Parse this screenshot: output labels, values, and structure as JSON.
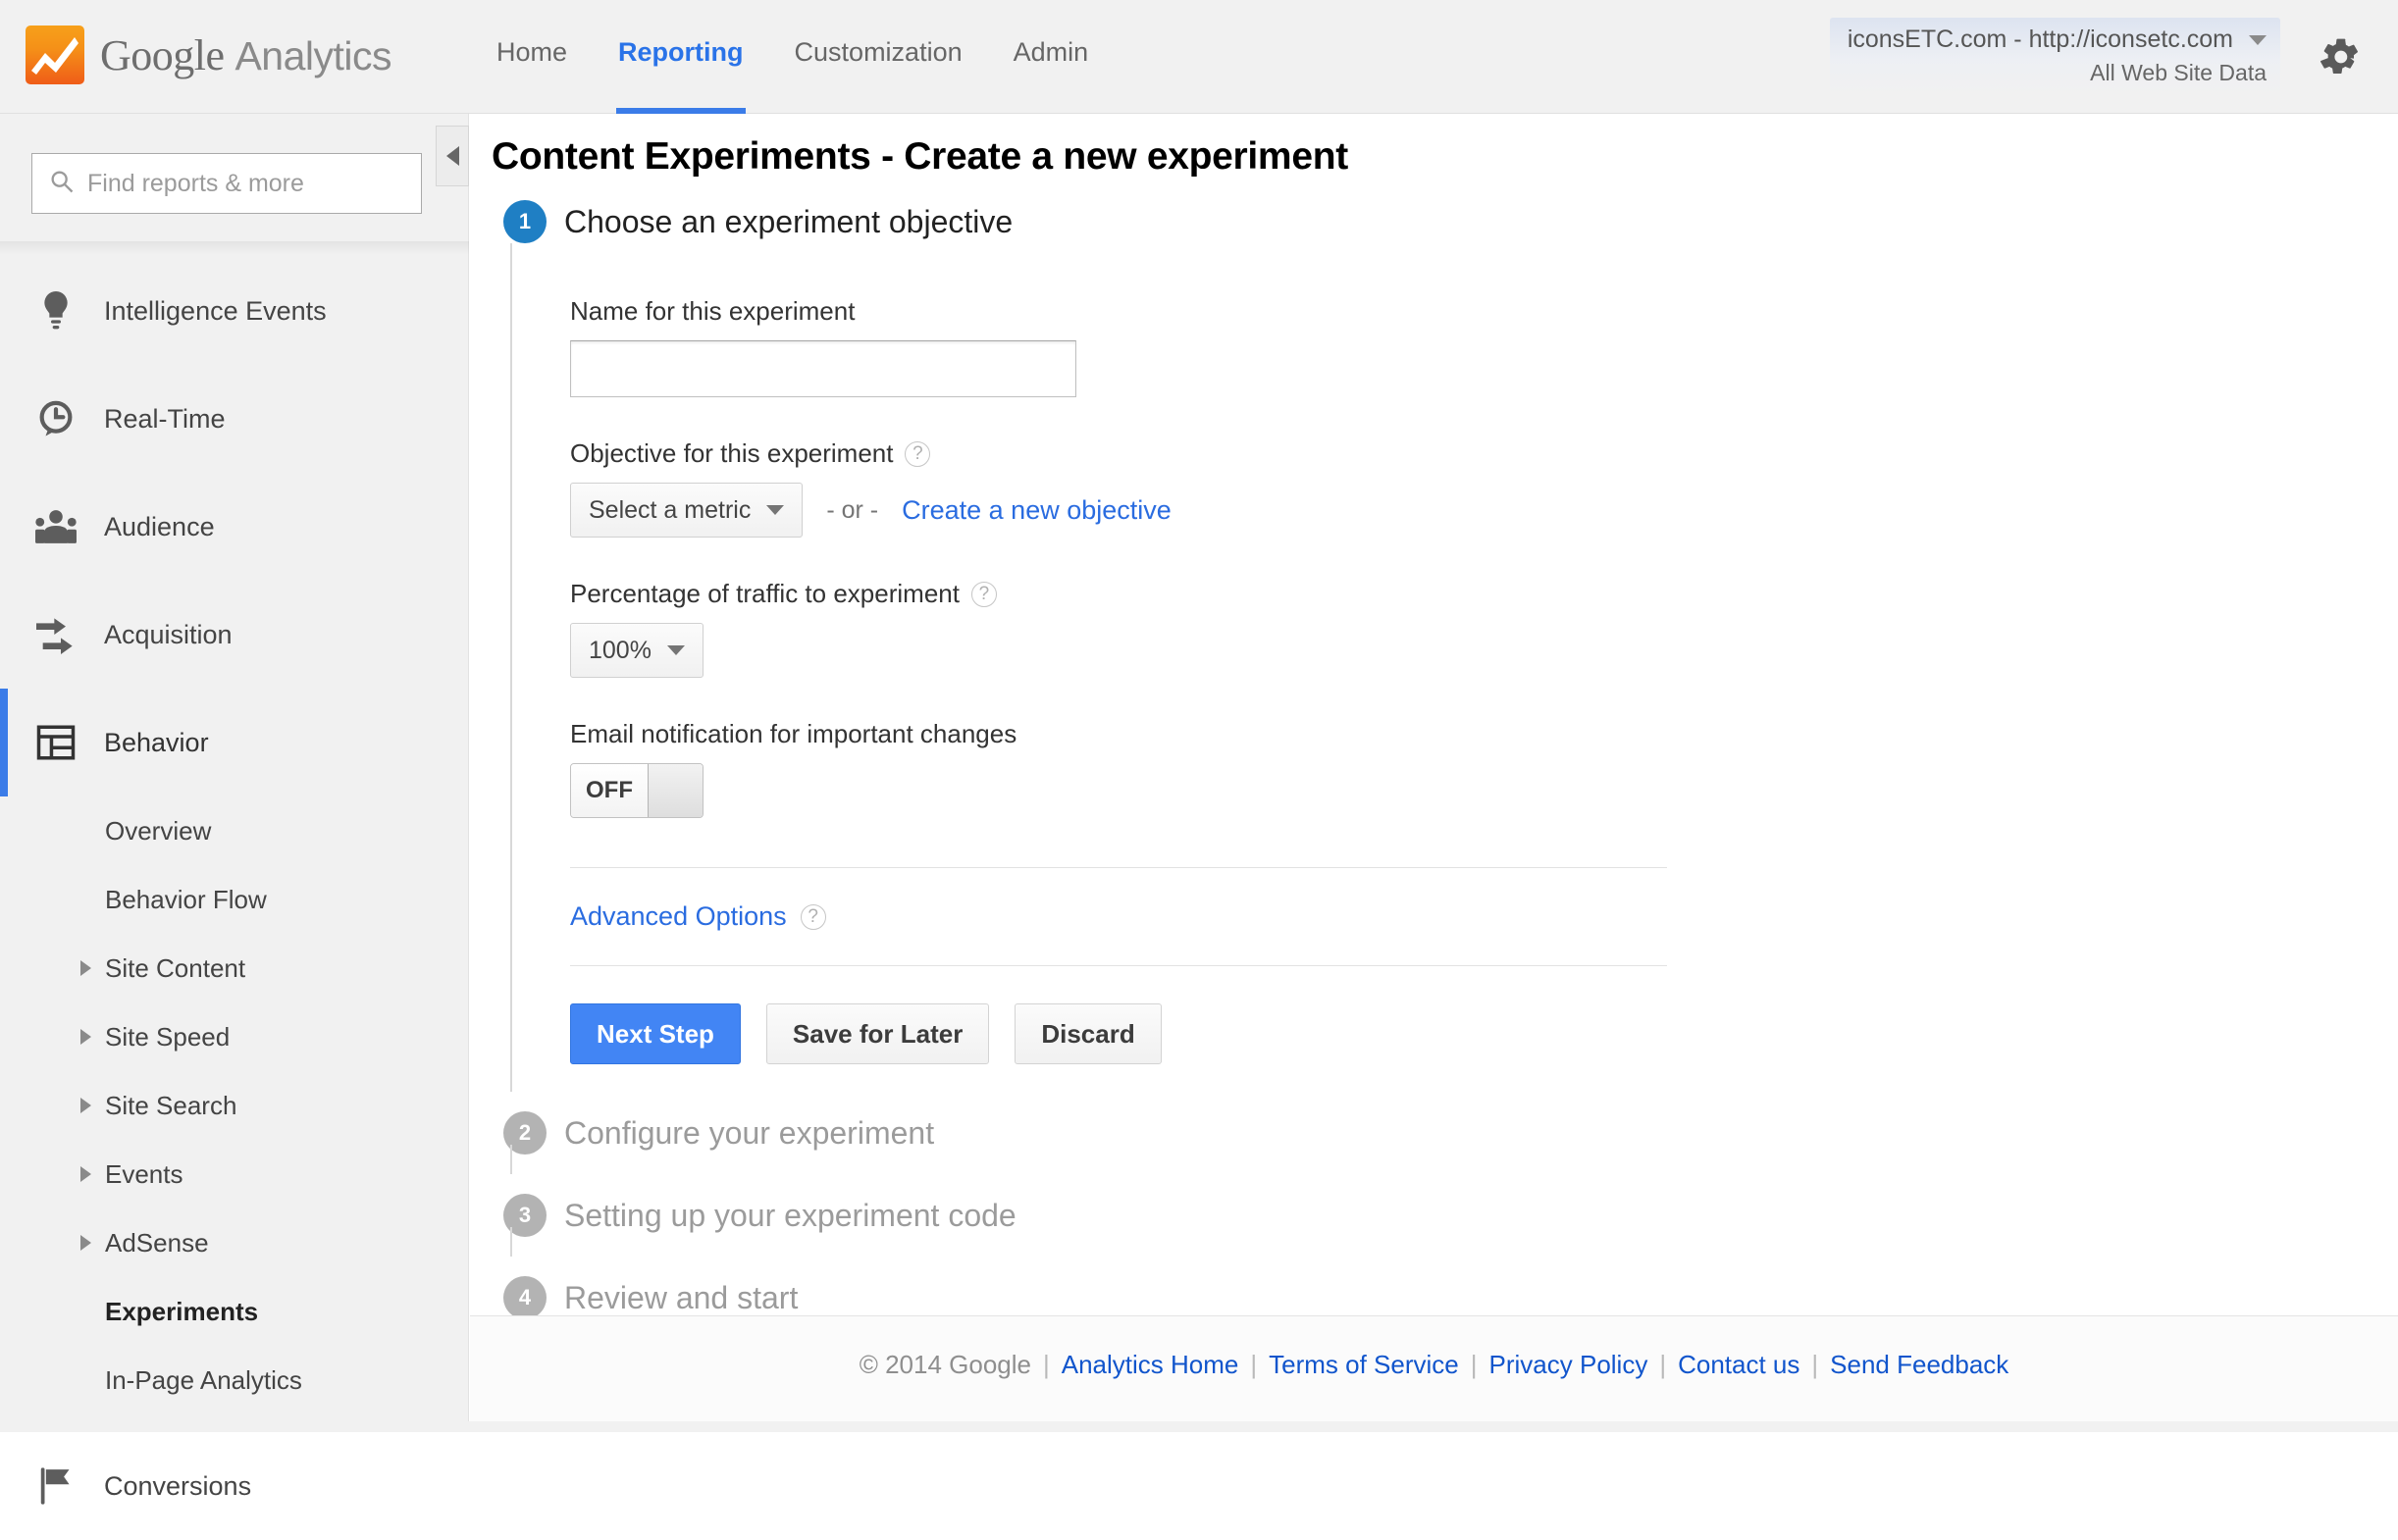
{
  "brand": {
    "name_google": "Google",
    "name_product": "Analytics",
    "logo_icon": "analytics-logo-icon"
  },
  "topnav": {
    "items": [
      {
        "label": "Home",
        "active": false
      },
      {
        "label": "Reporting",
        "active": true
      },
      {
        "label": "Customization",
        "active": false
      },
      {
        "label": "Admin",
        "active": false
      }
    ]
  },
  "account": {
    "property": "iconsETC.com - http://iconsetc.com",
    "view": "All Web Site Data",
    "caret_icon": "chevron-down-icon",
    "settings_icon": "gear-icon"
  },
  "sidebar": {
    "search": {
      "placeholder": "Find reports & more",
      "value": "",
      "icon": "search-icon"
    },
    "collapse_icon": "chevron-left-icon",
    "items": [
      {
        "label": "Intelligence Events",
        "icon": "lightbulb-icon",
        "active": false
      },
      {
        "label": "Real-Time",
        "icon": "clock-icon",
        "active": false
      },
      {
        "label": "Audience",
        "icon": "people-icon",
        "active": false
      },
      {
        "label": "Acquisition",
        "icon": "arrows-icon",
        "active": false
      },
      {
        "label": "Behavior",
        "icon": "layout-icon",
        "active": true
      },
      {
        "label": "Conversions",
        "icon": "flag-icon",
        "active": false
      }
    ],
    "behavior_subitems": [
      {
        "label": "Overview",
        "expandable": false,
        "selected": false
      },
      {
        "label": "Behavior Flow",
        "expandable": false,
        "selected": false
      },
      {
        "label": "Site Content",
        "expandable": true,
        "selected": false
      },
      {
        "label": "Site Speed",
        "expandable": true,
        "selected": false
      },
      {
        "label": "Site Search",
        "expandable": true,
        "selected": false
      },
      {
        "label": "Events",
        "expandable": true,
        "selected": false
      },
      {
        "label": "AdSense",
        "expandable": true,
        "selected": false
      },
      {
        "label": "Experiments",
        "expandable": false,
        "selected": true
      },
      {
        "label": "In-Page Analytics",
        "expandable": false,
        "selected": false
      }
    ]
  },
  "main": {
    "page_title": "Content Experiments - Create a new experiment",
    "steps": [
      {
        "number": "1",
        "title": "Choose an experiment objective",
        "active": true
      },
      {
        "number": "2",
        "title": "Configure your experiment",
        "active": false
      },
      {
        "number": "3",
        "title": "Setting up your experiment code",
        "active": false
      },
      {
        "number": "4",
        "title": "Review and start",
        "active": false
      }
    ],
    "form": {
      "name_label": "Name for this experiment",
      "name_value": "",
      "objective_label": "Objective for this experiment",
      "objective_help_icon": "help-icon",
      "objective_select_value": "Select a metric",
      "or_text": "- or -",
      "create_objective_link": "Create a new objective",
      "traffic_label": "Percentage of traffic to experiment",
      "traffic_help_icon": "help-icon",
      "traffic_select_value": "100%",
      "email_label": "Email notification for important changes",
      "email_toggle_state": "OFF",
      "advanced_options_link": "Advanced Options",
      "advanced_help_icon": "help-icon",
      "buttons": {
        "next": "Next Step",
        "save": "Save for Later",
        "discard": "Discard"
      }
    }
  },
  "footer": {
    "copyright": "© 2014 Google",
    "links": [
      "Analytics Home",
      "Terms of Service",
      "Privacy Policy",
      "Contact us",
      "Send Feedback"
    ],
    "separator": "|"
  },
  "colors": {
    "accent_blue": "#4285f4",
    "link_blue": "#1155cc",
    "step_active": "#1f7fc4",
    "step_inactive": "#b3b3b3",
    "logo_orange": "#f59018"
  }
}
